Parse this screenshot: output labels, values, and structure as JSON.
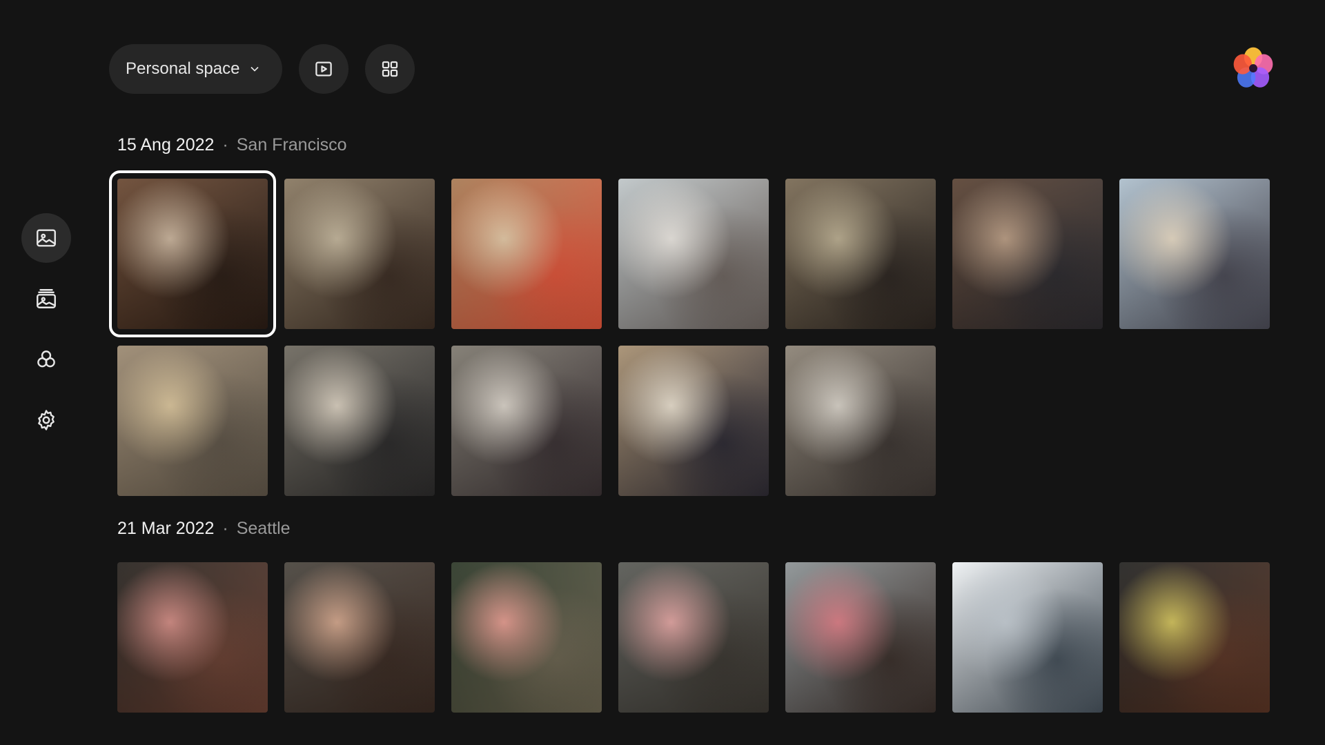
{
  "header": {
    "space_label": "Personal space"
  },
  "icons": {
    "nav": [
      "photos-icon",
      "albums-icon",
      "shared-icon",
      "settings-icon"
    ],
    "toolbar": [
      "slideshow-icon",
      "grid-view-icon",
      "chevron-down-icon",
      "app-logo-icon"
    ]
  },
  "sections": [
    {
      "date": "15 Ang 2022",
      "place": "San Francisco",
      "photos": [
        {
          "c1": "#6b4a34",
          "c2": "#c9b39b",
          "c3": "#2a1c14"
        },
        {
          "c1": "#8a7a63",
          "c2": "#c2b49a",
          "c3": "#3b2c22"
        },
        {
          "c1": "#a87b55",
          "c2": "#e2c7a4",
          "c3": "#e2553a"
        },
        {
          "c1": "#bfc6c8",
          "c2": "#e9e5df",
          "c3": "#6e6560"
        },
        {
          "c1": "#7b6c56",
          "c2": "#b8ab8e",
          "c3": "#2c2520"
        },
        {
          "c1": "#5c4536",
          "c2": "#b89b82",
          "c3": "#2c2a2e"
        },
        {
          "c1": "#aebfcc",
          "c2": "#e5d8c3",
          "c3": "#4a4a55"
        }
      ]
    },
    {
      "photos": [
        {
          "c1": "#9c8a72",
          "c2": "#d9c39a",
          "c3": "#5f5548"
        },
        {
          "c1": "#6f6a60",
          "c2": "#d7cdbd",
          "c3": "#2b2a2a"
        },
        {
          "c1": "#7f7a70",
          "c2": "#d8d1c7",
          "c3": "#3a3133"
        },
        {
          "c1": "#a79072",
          "c2": "#e6dccb",
          "c3": "#2d2a33"
        },
        {
          "c1": "#8d8477",
          "c2": "#d6d0c6",
          "c3": "#3d3632"
        }
      ]
    },
    {
      "date": "21 Mar 2022",
      "place": "Seattle",
      "photos": [
        {
          "c1": "#2a2622",
          "c2": "#d08a82",
          "c3": "#6a4032"
        },
        {
          "c1": "#4b463f",
          "c2": "#d1a48a",
          "c3": "#3a2a22"
        },
        {
          "c1": "#2f3a2a",
          "c2": "#e39a8e",
          "c3": "#6b6450"
        },
        {
          "c1": "#5a5b56",
          "c2": "#e0a3a0",
          "c3": "#3b3731"
        },
        {
          "c1": "#8d9395",
          "c2": "#d97c84",
          "c3": "#3a2f2a"
        },
        {
          "c1": "#eef1f3",
          "c2": "#c4ccd3",
          "c3": "#45505a"
        },
        {
          "c1": "#262624",
          "c2": "#d0c05a",
          "c3": "#5a3424"
        }
      ]
    }
  ]
}
